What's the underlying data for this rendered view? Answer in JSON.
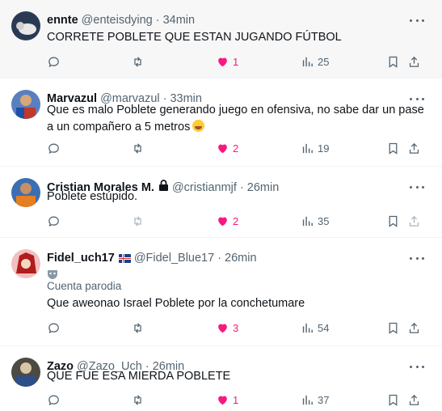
{
  "tweets": [
    {
      "name": "ennte",
      "handle": "@enteisdying",
      "time": "34min",
      "text": "CORRETE POBLETE QUE ESTAN JUGANDO FÚTBOL",
      "likes": "1",
      "views": "25",
      "liked": true,
      "avatar_colors": [
        "#2a3a55",
        "#e8e8e8"
      ]
    },
    {
      "name": "Marvazul",
      "handle": "@marvazul",
      "time": "33min",
      "text": "Que es malo Poblete generando juego en ofensiva, no sabe dar un pase a un compañero a 5 metros",
      "emoji": "sweat-smile-emoji",
      "likes": "2",
      "views": "19",
      "liked": true,
      "avatar_colors": [
        "#1f4fa8",
        "#c0392b"
      ]
    },
    {
      "name": "Cristian Morales M.",
      "handle": "@cristianmjf",
      "time": "26min",
      "text": "Poblete estúpido.",
      "likes": "2",
      "views": "35",
      "liked": true,
      "locked": true,
      "avatar_colors": [
        "#3b6fb3",
        "#e67e22"
      ]
    },
    {
      "name": "Fidel_uch17",
      "handle": "@Fidel_Blue17",
      "time": "26min",
      "parody_label": "Cuenta parodia",
      "text": "Que aweonao Israel Poblete por la conchetumare",
      "likes": "3",
      "views": "54",
      "liked": true,
      "flag": "iceland-flag",
      "avatar_colors": [
        "#b01d1d",
        "#f2c0c0"
      ]
    },
    {
      "name": "Zazo",
      "handle": "@Zazo_Uch",
      "time": "26min",
      "text": "QUE FUE ESA MIERDA POBLETE",
      "likes": "1",
      "views": "37",
      "liked": true,
      "avatar_colors": [
        "#4d4a44",
        "#d8c7a6"
      ]
    }
  ],
  "dot": "·",
  "icons": [
    "reply-icon",
    "retweet-icon",
    "heart-icon",
    "views-icon",
    "bookmark-icon",
    "share-icon",
    "more-icon",
    "lock-icon"
  ],
  "colors": {
    "like": "#f91880",
    "secondary": "#536471",
    "text": "#0f1419"
  }
}
